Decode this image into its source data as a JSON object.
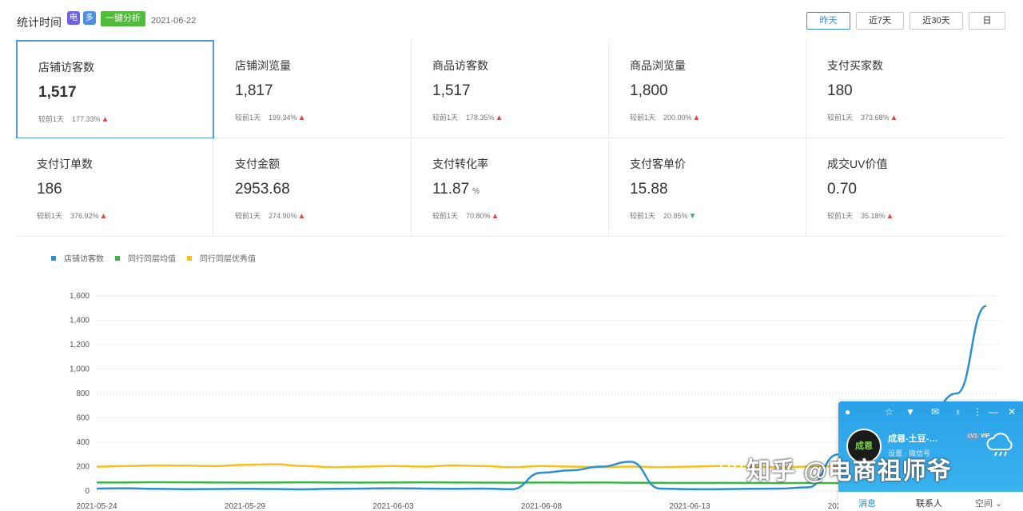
{
  "header": {
    "label": "统计时间",
    "app_icon_a": "电",
    "app_icon_b": "多",
    "analyze_label": "一键分析",
    "date": "2021-06-22",
    "ranges": [
      {
        "label": "昨天",
        "active": true
      },
      {
        "label": "近7天",
        "active": false
      },
      {
        "label": "近30天",
        "active": false
      },
      {
        "label": "日",
        "active": false
      }
    ]
  },
  "metrics": [
    {
      "label": "店铺访客数",
      "value": "1,517",
      "unit": "",
      "compare_label": "较前1天",
      "pct": "177.33%",
      "trend": "up",
      "selected": true
    },
    {
      "label": "店铺浏览量",
      "value": "1,817",
      "unit": "",
      "compare_label": "较前1天",
      "pct": "199.34%",
      "trend": "up"
    },
    {
      "label": "商品访客数",
      "value": "1,517",
      "unit": "",
      "compare_label": "较前1天",
      "pct": "178.35%",
      "trend": "up"
    },
    {
      "label": "商品浏览量",
      "value": "1,800",
      "unit": "",
      "compare_label": "较前1天",
      "pct": "200.00%",
      "trend": "up"
    },
    {
      "label": "支付买家数",
      "value": "180",
      "unit": "",
      "compare_label": "较前1天",
      "pct": "373.68%",
      "trend": "up"
    },
    {
      "label": "支付订单数",
      "value": "186",
      "unit": "",
      "compare_label": "较前1天",
      "pct": "376.92%",
      "trend": "up"
    },
    {
      "label": "支付金额",
      "value": "2953.68",
      "unit": "",
      "compare_label": "较前1天",
      "pct": "274.90%",
      "trend": "up"
    },
    {
      "label": "支付转化率",
      "value": "11.87",
      "unit": "%",
      "compare_label": "较前1天",
      "pct": "70.80%",
      "trend": "up"
    },
    {
      "label": "支付客单价",
      "value": "15.88",
      "unit": "",
      "compare_label": "较前1天",
      "pct": "20.85%",
      "trend": "down"
    },
    {
      "label": "成交UV价值",
      "value": "0.70",
      "unit": "",
      "compare_label": "较前1天",
      "pct": "35.18%",
      "trend": "up"
    }
  ],
  "colors": {
    "accent": "#3b8fd3",
    "series_visitors": "#2b8fd0",
    "series_peer_avg": "#3cb54a",
    "series_peer_excellent": "#f2c21b",
    "up": "#e24b3b",
    "down": "#3cb371"
  },
  "chart_data": {
    "type": "line",
    "ylim": [
      0,
      1600
    ],
    "yticks": [
      "0",
      "200",
      "400",
      "600",
      "800",
      "1,000",
      "1,200",
      "1,400",
      "1,600"
    ],
    "xticks": [
      "2021-05-24",
      "2021-05-29",
      "2021-06-03",
      "2021-06-08",
      "2021-06-13",
      "2021-"
    ],
    "legend_position": "top-left",
    "grid": true,
    "series": [
      {
        "name": "店铺访客数",
        "values": [
          20,
          22,
          18,
          15,
          16,
          18,
          16,
          14,
          18,
          20,
          22,
          20,
          18,
          20,
          15,
          150,
          170,
          200,
          240,
          20,
          15,
          15,
          18,
          20,
          30,
          300,
          400,
          500,
          600,
          800,
          1517
        ]
      },
      {
        "name": "同行同层均值",
        "values": [
          70,
          70,
          72,
          71,
          70,
          69,
          70,
          71,
          70,
          69,
          70,
          71,
          70,
          69,
          68,
          70,
          69,
          70,
          68,
          67,
          66,
          67,
          66,
          65,
          66,
          65,
          66,
          65,
          64,
          65,
          65
        ]
      },
      {
        "name": "同行同层优秀值",
        "values": [
          200,
          205,
          210,
          208,
          204,
          215,
          220,
          205,
          195,
          200,
          205,
          200,
          210,
          205,
          195,
          205,
          200,
          195,
          200,
          195,
          200,
          205,
          200,
          195,
          200,
          205,
          200,
          205,
          200,
          195,
          200
        ]
      }
    ]
  },
  "popup": {
    "avatar_text": "成恩",
    "name": "成恩-土豆-…",
    "badge": "LV1",
    "vip": "VIP",
    "signature": "设置 · 微信号",
    "tabs": [
      "消息",
      "联系人",
      "空间"
    ]
  },
  "watermark": "知乎 @电商祖师爷"
}
